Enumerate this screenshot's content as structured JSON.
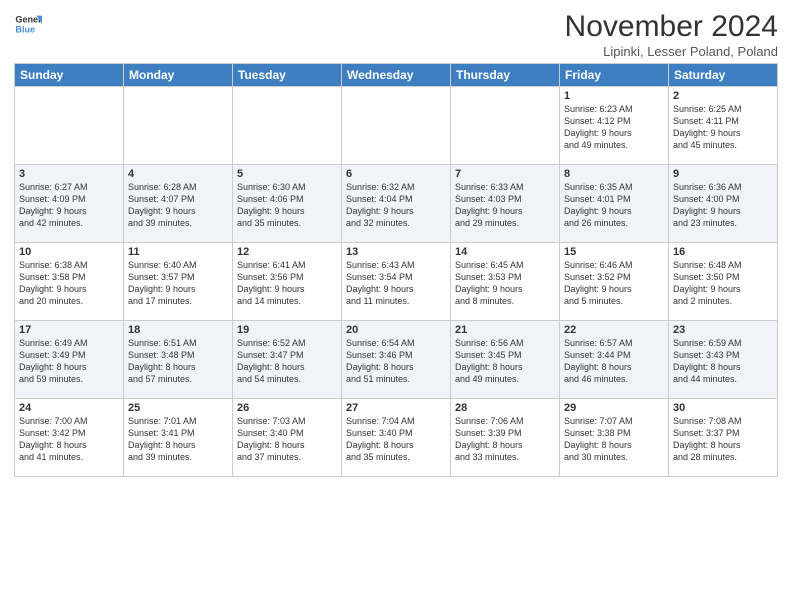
{
  "logo": {
    "line1": "General",
    "line2": "Blue"
  },
  "title": "November 2024",
  "subtitle": "Lipinki, Lesser Poland, Poland",
  "weekdays": [
    "Sunday",
    "Monday",
    "Tuesday",
    "Wednesday",
    "Thursday",
    "Friday",
    "Saturday"
  ],
  "weeks": [
    [
      {
        "day": "",
        "info": ""
      },
      {
        "day": "",
        "info": ""
      },
      {
        "day": "",
        "info": ""
      },
      {
        "day": "",
        "info": ""
      },
      {
        "day": "",
        "info": ""
      },
      {
        "day": "1",
        "info": "Sunrise: 6:23 AM\nSunset: 4:12 PM\nDaylight: 9 hours\nand 49 minutes."
      },
      {
        "day": "2",
        "info": "Sunrise: 6:25 AM\nSunset: 4:11 PM\nDaylight: 9 hours\nand 45 minutes."
      }
    ],
    [
      {
        "day": "3",
        "info": "Sunrise: 6:27 AM\nSunset: 4:09 PM\nDaylight: 9 hours\nand 42 minutes."
      },
      {
        "day": "4",
        "info": "Sunrise: 6:28 AM\nSunset: 4:07 PM\nDaylight: 9 hours\nand 39 minutes."
      },
      {
        "day": "5",
        "info": "Sunrise: 6:30 AM\nSunset: 4:06 PM\nDaylight: 9 hours\nand 35 minutes."
      },
      {
        "day": "6",
        "info": "Sunrise: 6:32 AM\nSunset: 4:04 PM\nDaylight: 9 hours\nand 32 minutes."
      },
      {
        "day": "7",
        "info": "Sunrise: 6:33 AM\nSunset: 4:03 PM\nDaylight: 9 hours\nand 29 minutes."
      },
      {
        "day": "8",
        "info": "Sunrise: 6:35 AM\nSunset: 4:01 PM\nDaylight: 9 hours\nand 26 minutes."
      },
      {
        "day": "9",
        "info": "Sunrise: 6:36 AM\nSunset: 4:00 PM\nDaylight: 9 hours\nand 23 minutes."
      }
    ],
    [
      {
        "day": "10",
        "info": "Sunrise: 6:38 AM\nSunset: 3:58 PM\nDaylight: 9 hours\nand 20 minutes."
      },
      {
        "day": "11",
        "info": "Sunrise: 6:40 AM\nSunset: 3:57 PM\nDaylight: 9 hours\nand 17 minutes."
      },
      {
        "day": "12",
        "info": "Sunrise: 6:41 AM\nSunset: 3:56 PM\nDaylight: 9 hours\nand 14 minutes."
      },
      {
        "day": "13",
        "info": "Sunrise: 6:43 AM\nSunset: 3:54 PM\nDaylight: 9 hours\nand 11 minutes."
      },
      {
        "day": "14",
        "info": "Sunrise: 6:45 AM\nSunset: 3:53 PM\nDaylight: 9 hours\nand 8 minutes."
      },
      {
        "day": "15",
        "info": "Sunrise: 6:46 AM\nSunset: 3:52 PM\nDaylight: 9 hours\nand 5 minutes."
      },
      {
        "day": "16",
        "info": "Sunrise: 6:48 AM\nSunset: 3:50 PM\nDaylight: 9 hours\nand 2 minutes."
      }
    ],
    [
      {
        "day": "17",
        "info": "Sunrise: 6:49 AM\nSunset: 3:49 PM\nDaylight: 8 hours\nand 59 minutes."
      },
      {
        "day": "18",
        "info": "Sunrise: 6:51 AM\nSunset: 3:48 PM\nDaylight: 8 hours\nand 57 minutes."
      },
      {
        "day": "19",
        "info": "Sunrise: 6:52 AM\nSunset: 3:47 PM\nDaylight: 8 hours\nand 54 minutes."
      },
      {
        "day": "20",
        "info": "Sunrise: 6:54 AM\nSunset: 3:46 PM\nDaylight: 8 hours\nand 51 minutes."
      },
      {
        "day": "21",
        "info": "Sunrise: 6:56 AM\nSunset: 3:45 PM\nDaylight: 8 hours\nand 49 minutes."
      },
      {
        "day": "22",
        "info": "Sunrise: 6:57 AM\nSunset: 3:44 PM\nDaylight: 8 hours\nand 46 minutes."
      },
      {
        "day": "23",
        "info": "Sunrise: 6:59 AM\nSunset: 3:43 PM\nDaylight: 8 hours\nand 44 minutes."
      }
    ],
    [
      {
        "day": "24",
        "info": "Sunrise: 7:00 AM\nSunset: 3:42 PM\nDaylight: 8 hours\nand 41 minutes."
      },
      {
        "day": "25",
        "info": "Sunrise: 7:01 AM\nSunset: 3:41 PM\nDaylight: 8 hours\nand 39 minutes."
      },
      {
        "day": "26",
        "info": "Sunrise: 7:03 AM\nSunset: 3:40 PM\nDaylight: 8 hours\nand 37 minutes."
      },
      {
        "day": "27",
        "info": "Sunrise: 7:04 AM\nSunset: 3:40 PM\nDaylight: 8 hours\nand 35 minutes."
      },
      {
        "day": "28",
        "info": "Sunrise: 7:06 AM\nSunset: 3:39 PM\nDaylight: 8 hours\nand 33 minutes."
      },
      {
        "day": "29",
        "info": "Sunrise: 7:07 AM\nSunset: 3:38 PM\nDaylight: 8 hours\nand 30 minutes."
      },
      {
        "day": "30",
        "info": "Sunrise: 7:08 AM\nSunset: 3:37 PM\nDaylight: 8 hours\nand 28 minutes."
      }
    ]
  ]
}
